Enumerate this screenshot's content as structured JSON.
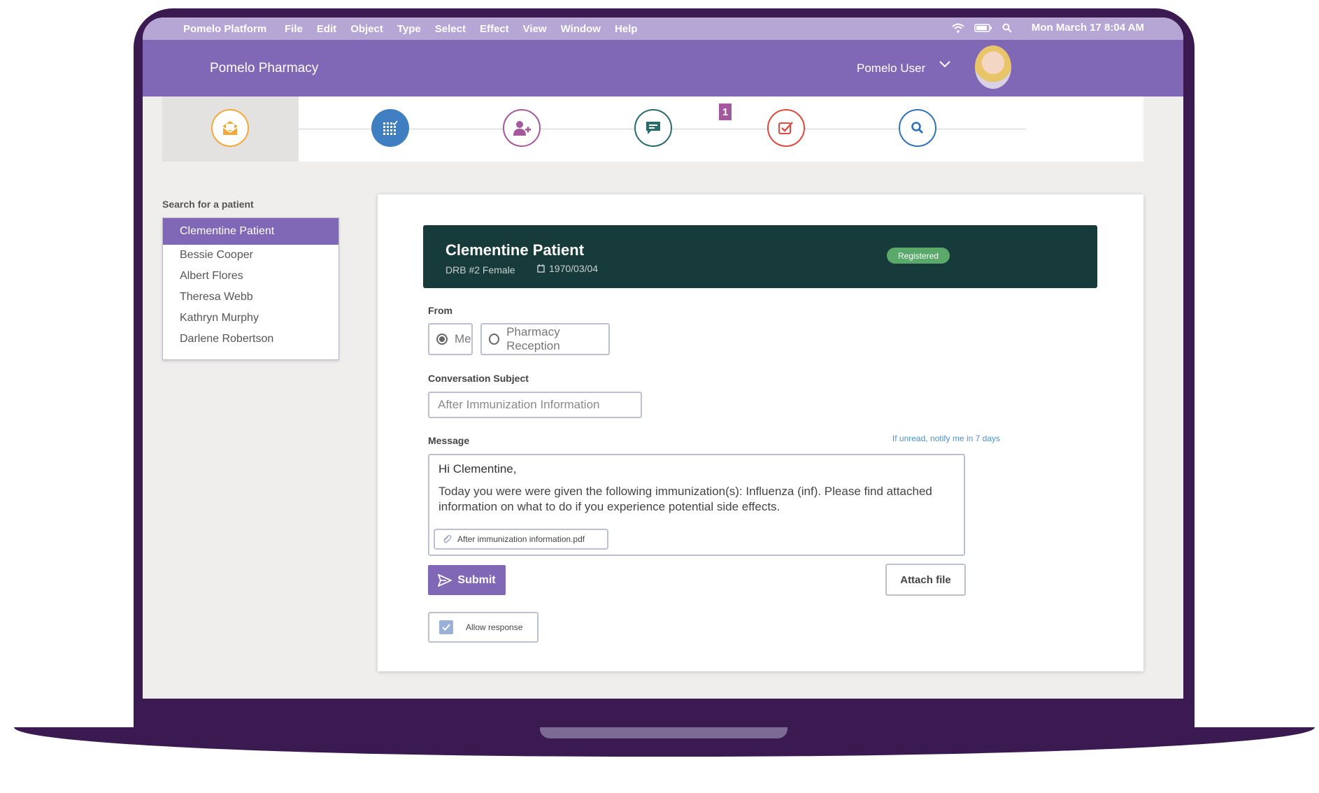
{
  "menubar": {
    "app_name": "Pomelo Platform",
    "items": [
      "File",
      "Edit",
      "Object",
      "Type",
      "Select",
      "Effect",
      "View",
      "Window",
      "Help"
    ],
    "clock": "Mon March 17  8:04 AM"
  },
  "header": {
    "pharmacy_name": "Pomelo Pharmacy",
    "user_name": "Pomelo User"
  },
  "nav": {
    "icons": [
      "mail-icon",
      "calendar-grid-icon",
      "add-patient-icon",
      "chat-icon",
      "task-check-icon",
      "search-icon"
    ],
    "badge_count": "1",
    "colors": {
      "mail": "#f2a93b",
      "calendar": "#3f7fc1",
      "patient": "#a4589e",
      "chat": "#2c6b6b",
      "task": "#e0493f",
      "search": "#2f72b8"
    }
  },
  "sidebar": {
    "label": "Search for a patient",
    "patients": [
      "Clementine Patient",
      "Bessie Cooper",
      "Albert Flores",
      "Theresa Webb",
      "Kathryn Murphy",
      "Darlene Robertson"
    ]
  },
  "patient": {
    "name": "Clementine Patient",
    "meta": "DRB #2 Female",
    "dob": "1970/03/04",
    "status": "Registered"
  },
  "form": {
    "from_label": "From",
    "from_options": [
      "Me",
      "Pharmacy Reception"
    ],
    "subject_label": "Conversation Subject",
    "subject_value": "After Immunization Information",
    "message_label": "Message",
    "notify_text": "If unread, notify me in 7 days",
    "message_greeting": "Hi Clementine,",
    "message_body": "Today you were were given the following immunization(s): Influenza (inf). Please find attached information on what to do if you experience potential side effects.",
    "attachment": "After immunization information.pdf",
    "submit_label": "Submit",
    "attach_label": "Attach file",
    "allow_response_label": "Allow response"
  },
  "colors": {
    "accent": "#8068b7",
    "frame": "#3b1a52",
    "banner": "#173a3a",
    "registered": "#5aa86a"
  }
}
